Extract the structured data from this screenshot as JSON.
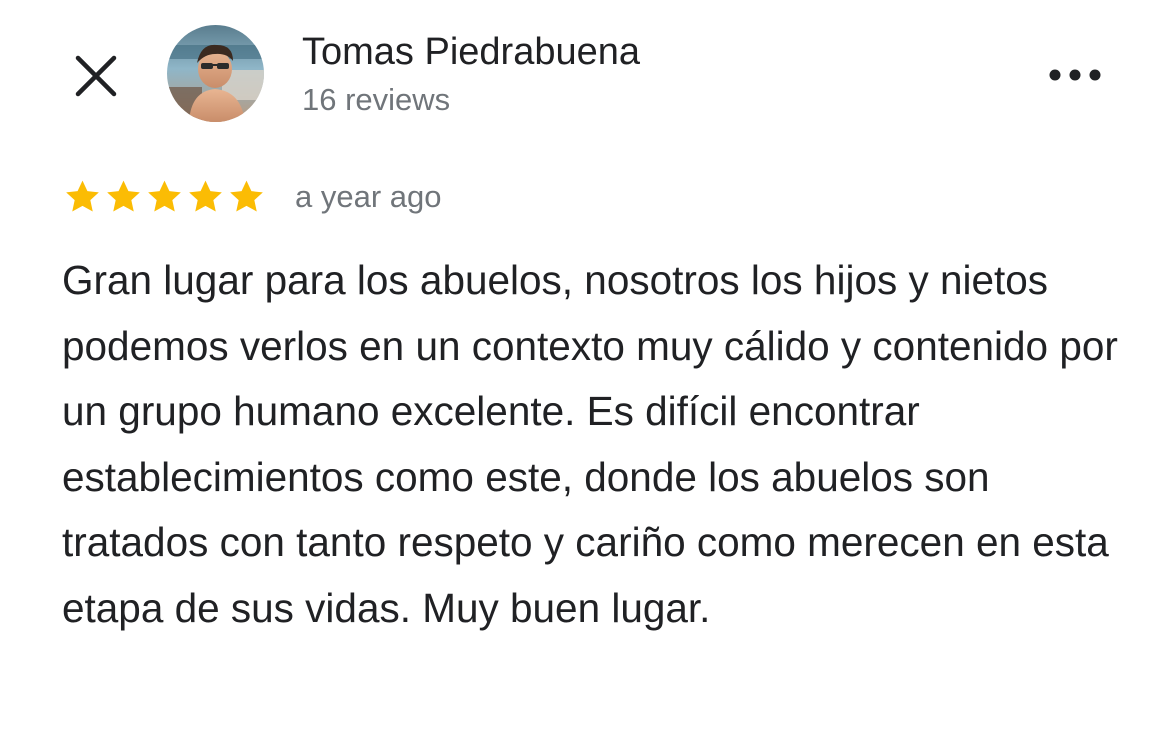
{
  "header": {
    "close_icon": "close-icon",
    "user": {
      "name": "Tomas Piedrabuena",
      "reviews": "16 reviews",
      "avatar": "profile-photo"
    },
    "more_icon": "more-horizontal-icon"
  },
  "review": {
    "rating": 5,
    "rating_max": 5,
    "star_color": "#fbbc04",
    "time": "a year ago",
    "text": "Gran lugar para los abuelos, nosotros los hijos y nietos podemos verlos en un contexto muy cálido y contenido por un grupo humano excelente. Es difícil encontrar establecimientos como este, donde los abuelos son tratados con tanto respeto y cariño como merecen en esta etapa de sus vidas. Muy buen lugar."
  }
}
